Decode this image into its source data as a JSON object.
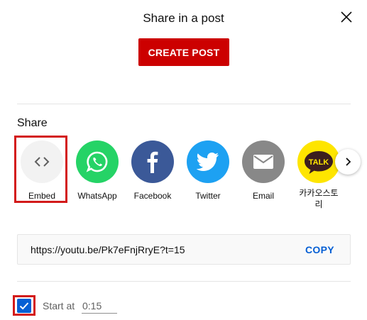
{
  "dialog": {
    "title": "Share in a post",
    "create_post_label": "CREATE POST",
    "close_icon": "close-icon"
  },
  "share": {
    "heading": "Share",
    "items": [
      {
        "label": "Embed",
        "icon": "embed-code-icon",
        "color": "#f2f2f2"
      },
      {
        "label": "WhatsApp",
        "icon": "whatsapp-icon",
        "color": "#25d366"
      },
      {
        "label": "Facebook",
        "icon": "facebook-icon",
        "color": "#3b5998"
      },
      {
        "label": "Twitter",
        "icon": "twitter-icon",
        "color": "#1da1f2"
      },
      {
        "label": "Email",
        "icon": "email-icon",
        "color": "#888888"
      },
      {
        "label": "카카오스토리",
        "icon": "kakao-talk-icon",
        "color": "#fee500"
      }
    ],
    "next_icon": "chevron-right-icon"
  },
  "link": {
    "url": "https://youtu.be/Pk7eFnjRryE?t=15",
    "copy_label": "COPY"
  },
  "start_at": {
    "checked": true,
    "label": "Start at",
    "value": "0:15"
  },
  "colors": {
    "accent_red": "#cc0000",
    "highlight_red": "#d31a1a",
    "link_blue": "#065fd4"
  }
}
